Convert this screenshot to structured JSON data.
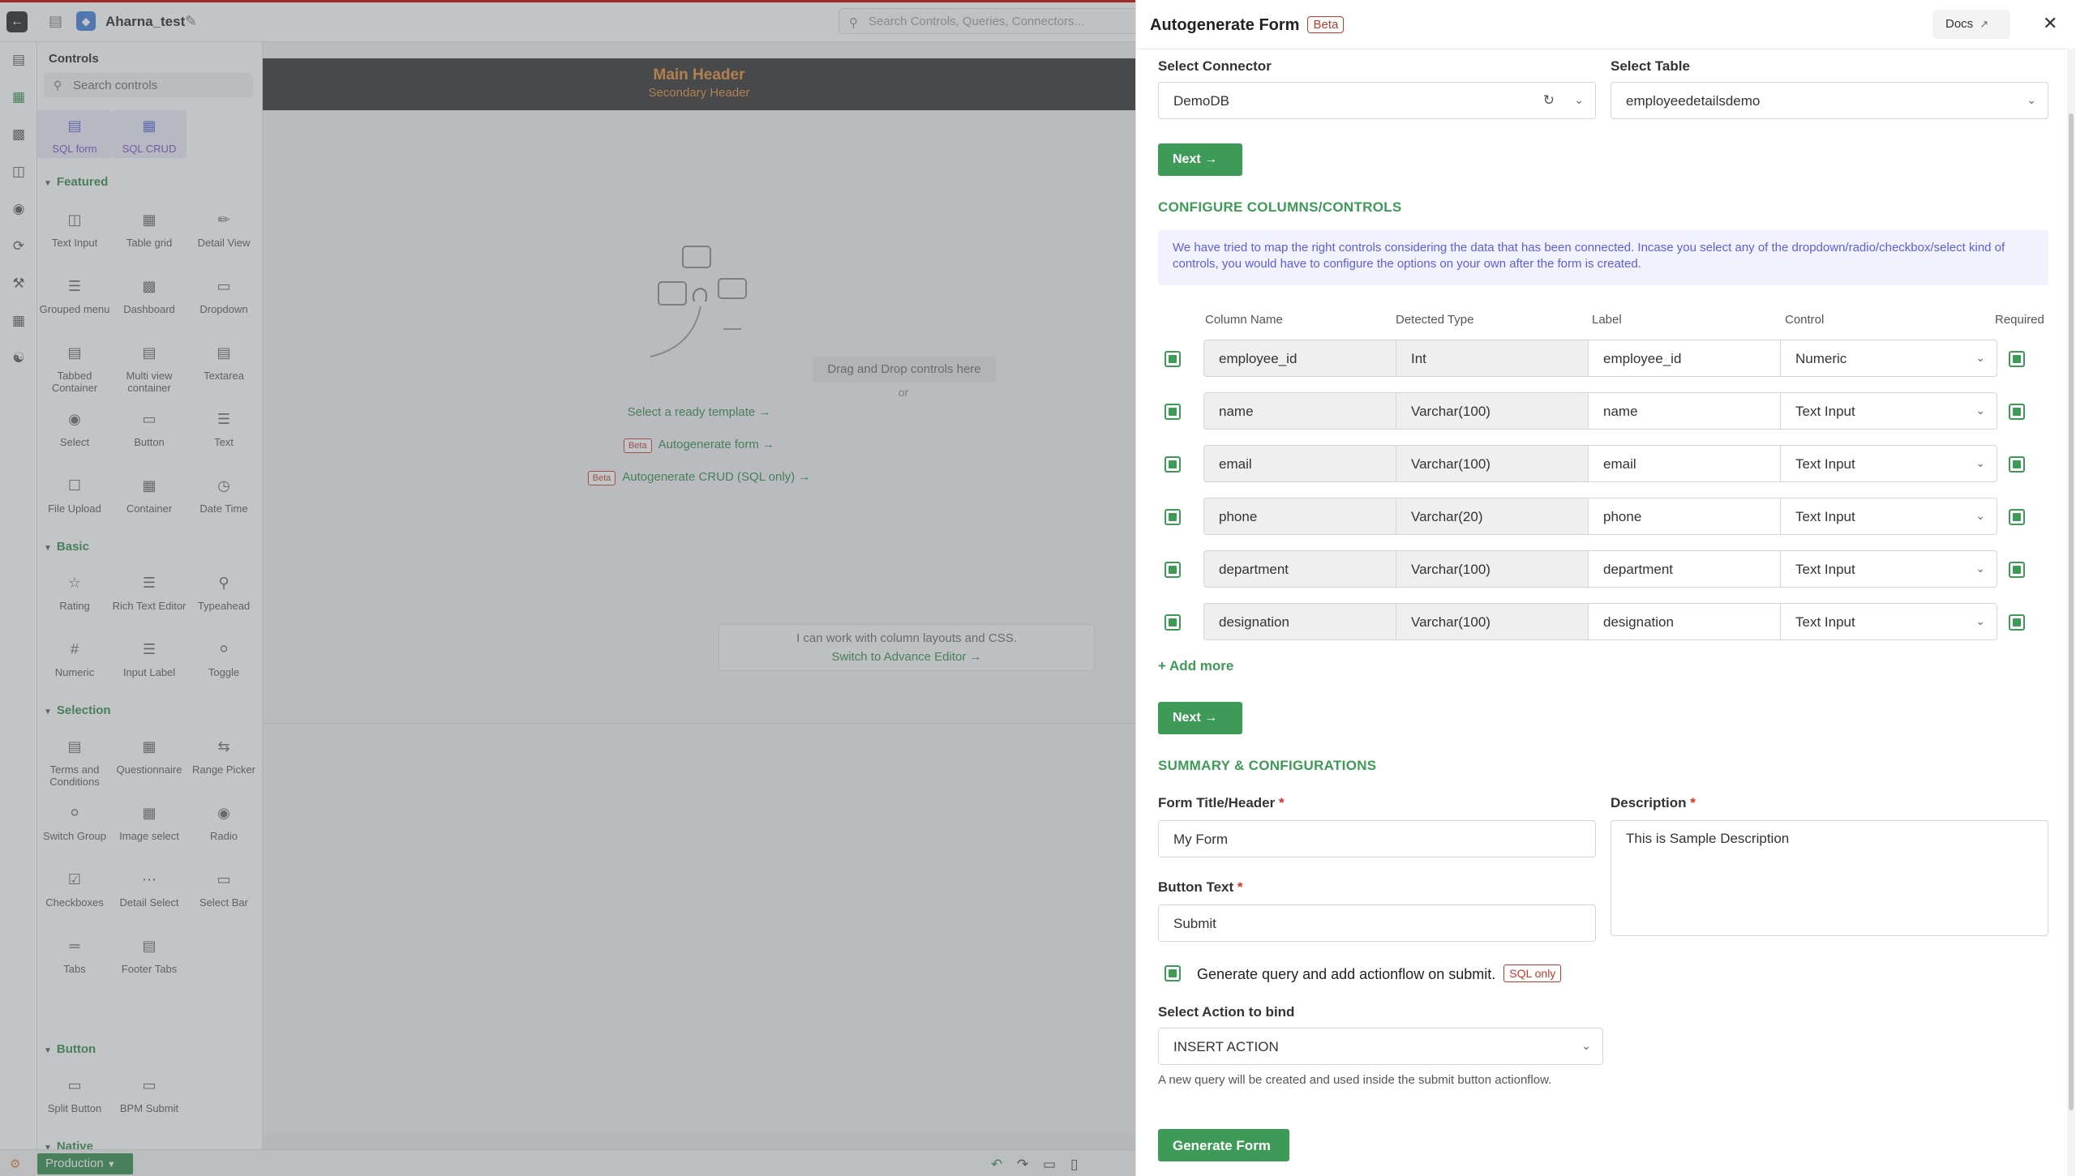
{
  "app": {
    "name": "Aharna_test",
    "search_placeholder": "Search Controls, Queries, Connectors..."
  },
  "panel": {
    "title": "Controls",
    "search_placeholder": "Search controls",
    "top_items": [
      "SQL form",
      "SQL CRUD"
    ],
    "sections": [
      {
        "title": "Featured",
        "items": [
          "Text Input",
          "Table grid",
          "Detail View",
          "Grouped menu",
          "Dashboard",
          "Dropdown",
          "Tabbed Container",
          "Multi view container",
          "Textarea",
          "Select",
          "Button",
          "Text",
          "File Upload",
          "Container",
          "Date Time"
        ]
      },
      {
        "title": "Basic",
        "items": [
          "Rating",
          "Rich Text Editor",
          "Typeahead",
          "Numeric",
          "Input Label",
          "Toggle"
        ]
      },
      {
        "title": "Selection",
        "items": [
          "Terms and Conditions",
          "Questionnaire",
          "Range Picker",
          "Switch Group",
          "Image select",
          "Radio",
          "Checkboxes",
          "Detail Select",
          "Select Bar",
          "Tabs",
          "Footer Tabs"
        ]
      },
      {
        "title": "Button",
        "items": [
          "Split Button",
          "BPM Submit"
        ]
      },
      {
        "title": "Native",
        "items": []
      }
    ]
  },
  "canvas": {
    "main_header": "Main Header",
    "secondary_header": "Secondary Header",
    "drop_text": "Drag and Drop controls here",
    "or_text": "or",
    "ready_template": "Select a ready template",
    "beta_label": "Beta",
    "autogen_form": "Autogenerate form",
    "autogen_crud": "Autogenerate CRUD (SQL only)",
    "adv_line1": "I can work with column layouts and CSS.",
    "adv_line2": "Switch to Advance Editor"
  },
  "bottombar": {
    "env": "Production"
  },
  "modal": {
    "title": "Autogenerate Form",
    "beta": "Beta",
    "docs": "Docs",
    "select_connector_label": "Select Connector",
    "connector_value": "DemoDB",
    "select_table_label": "Select Table",
    "table_value": "employeedetailsdemo",
    "next_label": "Next",
    "configure_title": "CONFIGURE COLUMNS/CONTROLS",
    "info_text": "We have tried to map the right controls considering the data that has been connected. Incase you select any of the dropdown/radio/checkbox/select kind of controls, you would have to configure the options on your own after the form is created.",
    "headers": {
      "column": "Column Name",
      "type": "Detected Type",
      "label": "Label",
      "control": "Control",
      "required": "Required"
    },
    "rows": [
      {
        "column": "employee_id",
        "type": "Int",
        "label": "employee_id",
        "control": "Numeric"
      },
      {
        "column": "name",
        "type": "Varchar(100)",
        "label": "name",
        "control": "Text Input"
      },
      {
        "column": "email",
        "type": "Varchar(100)",
        "label": "email",
        "control": "Text Input"
      },
      {
        "column": "phone",
        "type": "Varchar(20)",
        "label": "phone",
        "control": "Text Input"
      },
      {
        "column": "department",
        "type": "Varchar(100)",
        "label": "department",
        "control": "Text Input"
      },
      {
        "column": "designation",
        "type": "Varchar(100)",
        "label": "designation",
        "control": "Text Input"
      }
    ],
    "add_more": "Add more",
    "summary_title": "SUMMARY & CONFIGURATIONS",
    "form_title_label": "Form Title/Header",
    "form_title_value": "My Form",
    "description_label": "Description",
    "description_value": "This is Sample Description",
    "button_text_label": "Button Text",
    "button_text_value": "Submit",
    "generate_query_text": "Generate query and add actionflow on submit.",
    "sql_only": "SQL only",
    "select_action_label": "Select Action to bind",
    "action_value": "INSERT ACTION",
    "hint": "A new query will be created and used inside the submit button actionflow.",
    "generate_button": "Generate Form",
    "required_mark": "*"
  }
}
